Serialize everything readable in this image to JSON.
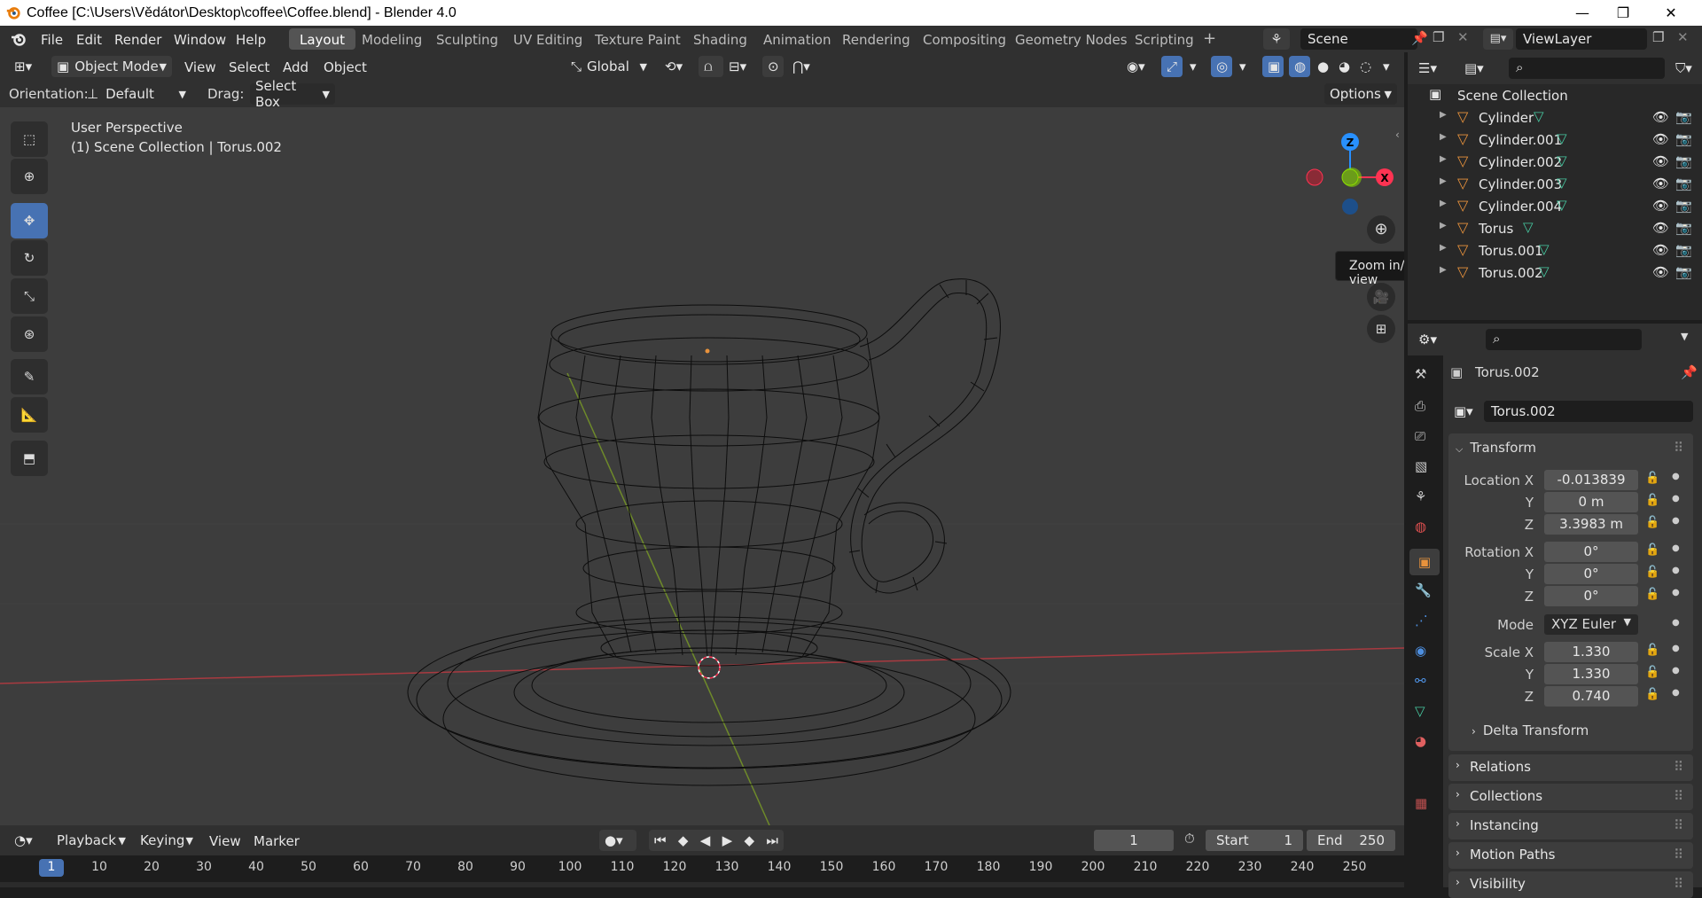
{
  "titlebar": {
    "title": "Coffee [C:\\Users\\Vědátor\\Desktop\\coffee\\Coffee.blend] - Blender 4.0"
  },
  "menus": [
    "File",
    "Edit",
    "Render",
    "Window",
    "Help"
  ],
  "workspaces": [
    "Layout",
    "Modeling",
    "Sculpting",
    "UV Editing",
    "Texture Paint",
    "Shading",
    "Animation",
    "Rendering",
    "Compositing",
    "Geometry Nodes",
    "Scripting"
  ],
  "active_workspace": "Layout",
  "scene": "Scene",
  "view_layer": "ViewLayer",
  "viewport_header": {
    "mode": "Object Mode",
    "menus": [
      "View",
      "Select",
      "Add",
      "Object"
    ],
    "transform_orientation": "Global"
  },
  "tool_header": {
    "orientation_label": "Orientation:",
    "orientation_value": "Default",
    "drag_label": "Drag:",
    "drag_value": "Select Box",
    "options": "Options"
  },
  "viewport_info": {
    "line1": "User Perspective",
    "line2": "(1) Scene Collection | Torus.002"
  },
  "tooltip": "Zoom in/out in the view",
  "gizmo": {
    "z": "Z",
    "x": "X"
  },
  "outliner": {
    "root": "Scene Collection",
    "items": [
      {
        "name": "Cylinder"
      },
      {
        "name": "Cylinder.001"
      },
      {
        "name": "Cylinder.002"
      },
      {
        "name": "Cylinder.003"
      },
      {
        "name": "Cylinder.004"
      },
      {
        "name": "Torus"
      },
      {
        "name": "Torus.001"
      },
      {
        "name": "Torus.002"
      }
    ]
  },
  "properties": {
    "object_name": "Torus.002",
    "datablock": "Torus.002",
    "transform": {
      "header": "Transform",
      "location_label": "Location X",
      "location": [
        "-0.013839",
        "0 m",
        "3.3983 m"
      ],
      "rotation_label": "Rotation X",
      "rotation": [
        "0°",
        "0°",
        "0°"
      ],
      "mode_label": "Mode",
      "mode": "XYZ Euler",
      "scale_label": "Scale X",
      "scale": [
        "1.330",
        "1.330",
        "0.740"
      ],
      "y": "Y",
      "z": "Z",
      "delta": "Delta Transform"
    },
    "panels": [
      "Relations",
      "Collections",
      "Instancing",
      "Motion Paths",
      "Visibility"
    ]
  },
  "timeline": {
    "menus": [
      "Playback",
      "Keying",
      "View",
      "Marker"
    ],
    "current_frame": "1",
    "start_label": "Start",
    "start": "1",
    "end_label": "End",
    "end": "250",
    "ruler": [
      "1",
      "10",
      "20",
      "30",
      "40",
      "50",
      "60",
      "70",
      "80",
      "90",
      "100",
      "110",
      "120",
      "130",
      "140",
      "150",
      "160",
      "170",
      "180",
      "190",
      "200",
      "210",
      "220",
      "230",
      "240",
      "250"
    ]
  },
  "colors": {
    "accent": "#4772b3",
    "x_axis": "#ff3352",
    "y_axis": "#8bdc00",
    "z_axis": "#2890ff",
    "object_orange": "#e8923c",
    "mesh_green": "#46c8a0"
  }
}
